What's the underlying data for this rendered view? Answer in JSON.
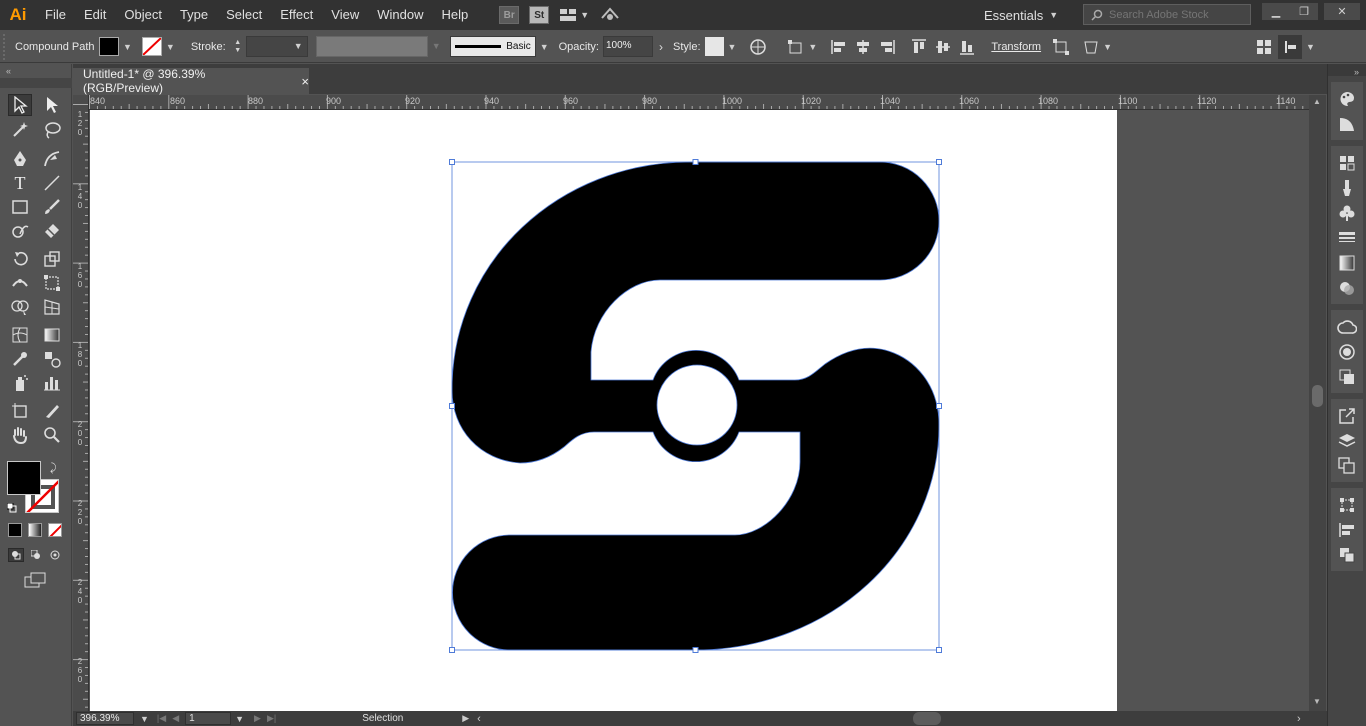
{
  "app": {
    "logo": "Ai"
  },
  "menu": [
    "File",
    "Edit",
    "Object",
    "Type",
    "Select",
    "Effect",
    "View",
    "Window",
    "Help"
  ],
  "bridge_badges": {
    "br": "Br",
    "st": "St"
  },
  "workspace": {
    "label": "Essentials"
  },
  "search": {
    "placeholder": "Search Adobe Stock"
  },
  "control_bar": {
    "object_type": "Compound Path",
    "stroke_label": "Stroke:",
    "brush_label": "Basic",
    "opacity_label": "Opacity:",
    "opacity_value": "100%",
    "style_label": "Style:",
    "transform_label": "Transform"
  },
  "document": {
    "tab_title": "Untitled-1* @ 396.39% (RGB/Preview)",
    "close": "×"
  },
  "ruler": {
    "h_labels": [
      "840",
      "860",
      "880",
      "900",
      "920",
      "940",
      "960",
      "980",
      "1000",
      "1020",
      "1040",
      "1060",
      "1080",
      "1100",
      "1120",
      "1140"
    ],
    "v_labels": [
      "120",
      "140",
      "160",
      "180",
      "200",
      "220",
      "240",
      "260"
    ]
  },
  "status": {
    "zoom": "396.39%",
    "artboard": "1",
    "tool": "Selection"
  },
  "colors": {
    "fill": "#000000",
    "stroke": "none",
    "selection": "#4f7bd8",
    "accent": "#ff9a00"
  },
  "icons": {
    "tools": [
      "selection-tool-icon",
      "direct-selection-tool-icon",
      "magic-wand-icon",
      "lasso-icon",
      "pen-tool-icon",
      "curvature-tool-icon",
      "type-tool-icon",
      "line-tool-icon",
      "rectangle-tool-icon",
      "paintbrush-icon",
      "shaper-tool-icon",
      "eraser-icon",
      "rotate-tool-icon",
      "scale-tool-icon",
      "width-tool-icon",
      "free-transform-icon",
      "shape-builder-icon",
      "perspective-grid-icon",
      "mesh-tool-icon",
      "gradient-tool-icon",
      "eyedropper-icon",
      "blend-tool-icon",
      "symbol-sprayer-icon",
      "column-graph-icon",
      "artboard-tool-icon",
      "slice-tool-icon",
      "hand-tool-icon",
      "zoom-tool-icon"
    ]
  }
}
